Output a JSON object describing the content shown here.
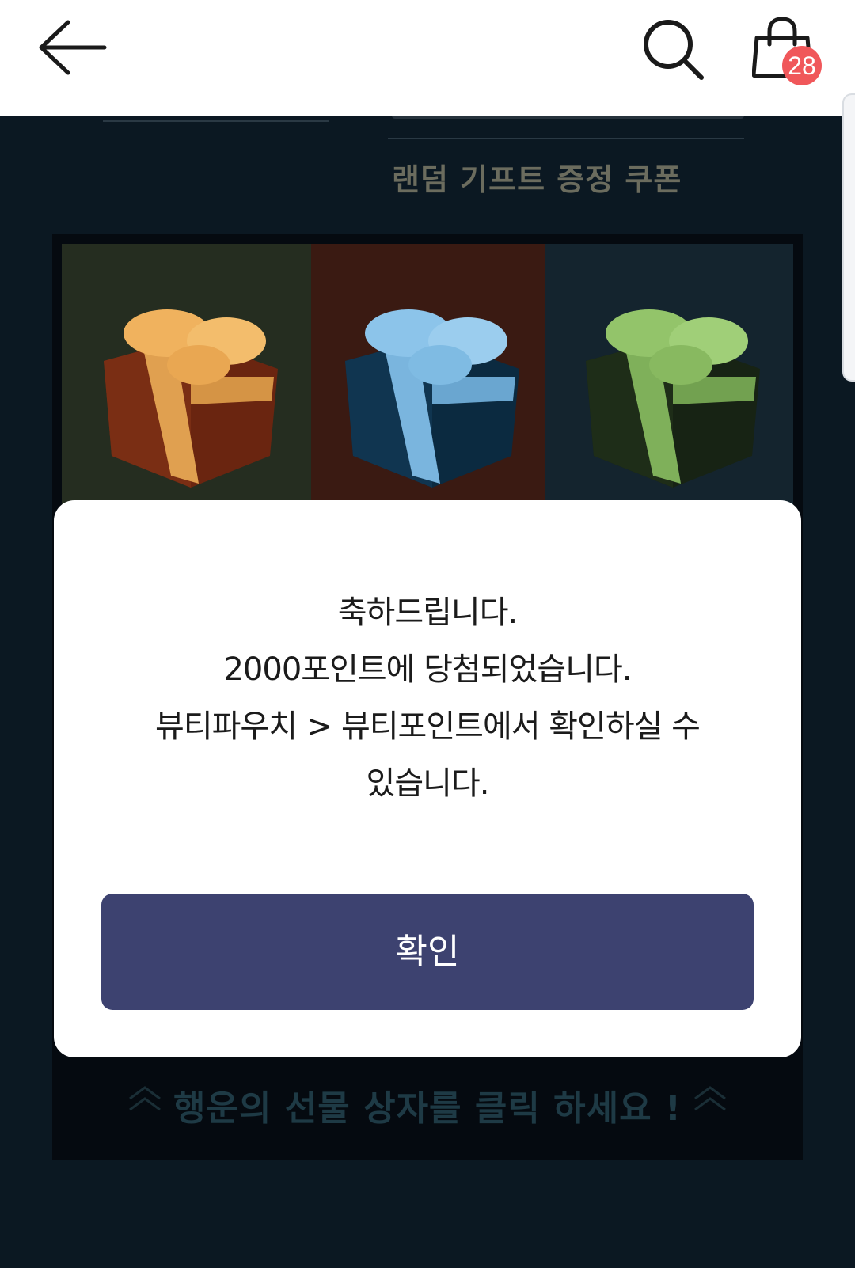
{
  "header": {
    "back_icon": "arrow-left-icon",
    "search_icon": "search-icon",
    "cart_icon": "shopping-bag-icon",
    "cart_count": "28",
    "badge_color": "#f0575a"
  },
  "background": {
    "coupon_label": "랜덤 기프트 증정 쿠폰",
    "cta_text": "행운의 선물 상자를 클릭 하세요 !",
    "gifts": [
      {
        "name": "gift-box-orange",
        "box_color": "#7a2a12",
        "ribbon_color": "#f0b25e"
      },
      {
        "name": "gift-box-blue",
        "box_color": "#0f3550",
        "ribbon_color": "#8cc4ea"
      },
      {
        "name": "gift-box-green",
        "box_color": "#1c2a16",
        "ribbon_color": "#93c46a"
      }
    ]
  },
  "dialog": {
    "lines": [
      "축하드립니다.",
      "2000포인트에 당첨되었습니다.",
      "뷰티파우치 > 뷰티포인트에서 확인하실 수",
      "있습니다."
    ],
    "confirm_label": "확인",
    "button_color": "#3d4270"
  }
}
